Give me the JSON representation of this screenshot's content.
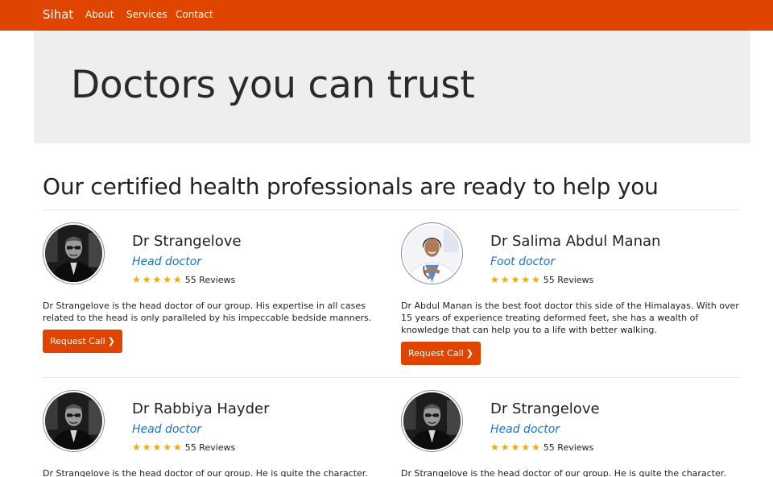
{
  "nav": {
    "brand": "Sihat",
    "links": [
      "About",
      "Services",
      "Contact"
    ]
  },
  "hero": {
    "title": "Doctors you can trust"
  },
  "section": {
    "title": "Our certified health professionals are ready to help you"
  },
  "doctors": [
    {
      "name": "Dr Strangelove",
      "role": "Head doctor",
      "stars": "★★★★★",
      "reviews": "55 Reviews",
      "description": "Dr Strangelove is the head doctor of our group. His expertise in all cases related to the head is only paralleled by his impeccable bedside manners.",
      "button": "Request Call",
      "avatar": "portrait-bw-man"
    },
    {
      "name": "Dr Salima Abdul Manan",
      "role": "Foot doctor",
      "stars": "★★★★★",
      "reviews": "55 Reviews",
      "description": "Dr Abdul Manan is the best foot doctor this side of the Himalayas. With over 15 years of experience treating deformed feet, she has a wealth of knowledge that can help you to a life with better walking.",
      "button": "Request Call",
      "avatar": "portrait-woman-doctor"
    },
    {
      "name": "Dr Rabbiya Hayder",
      "role": "Head doctor",
      "stars": "★★★★★",
      "reviews": "55 Reviews",
      "description": "Dr Strangelove is the head doctor of our group. He is quite the character. Also, he likes",
      "avatar": "portrait-bw-man"
    },
    {
      "name": "Dr Strangelove",
      "role": "Head doctor",
      "stars": "★★★★★",
      "reviews": "55 Reviews",
      "description": "Dr Strangelove is the head doctor of our group. He is quite the character. Also, he likes",
      "avatar": "portrait-bw-man"
    }
  ],
  "colors": {
    "brand": "#e04500",
    "role": "#1a73c7",
    "star": "#f2a900",
    "jumbotron": "#eeeeee"
  },
  "icons": {
    "chevron": "chevron-right-icon",
    "star": "star-icon"
  }
}
